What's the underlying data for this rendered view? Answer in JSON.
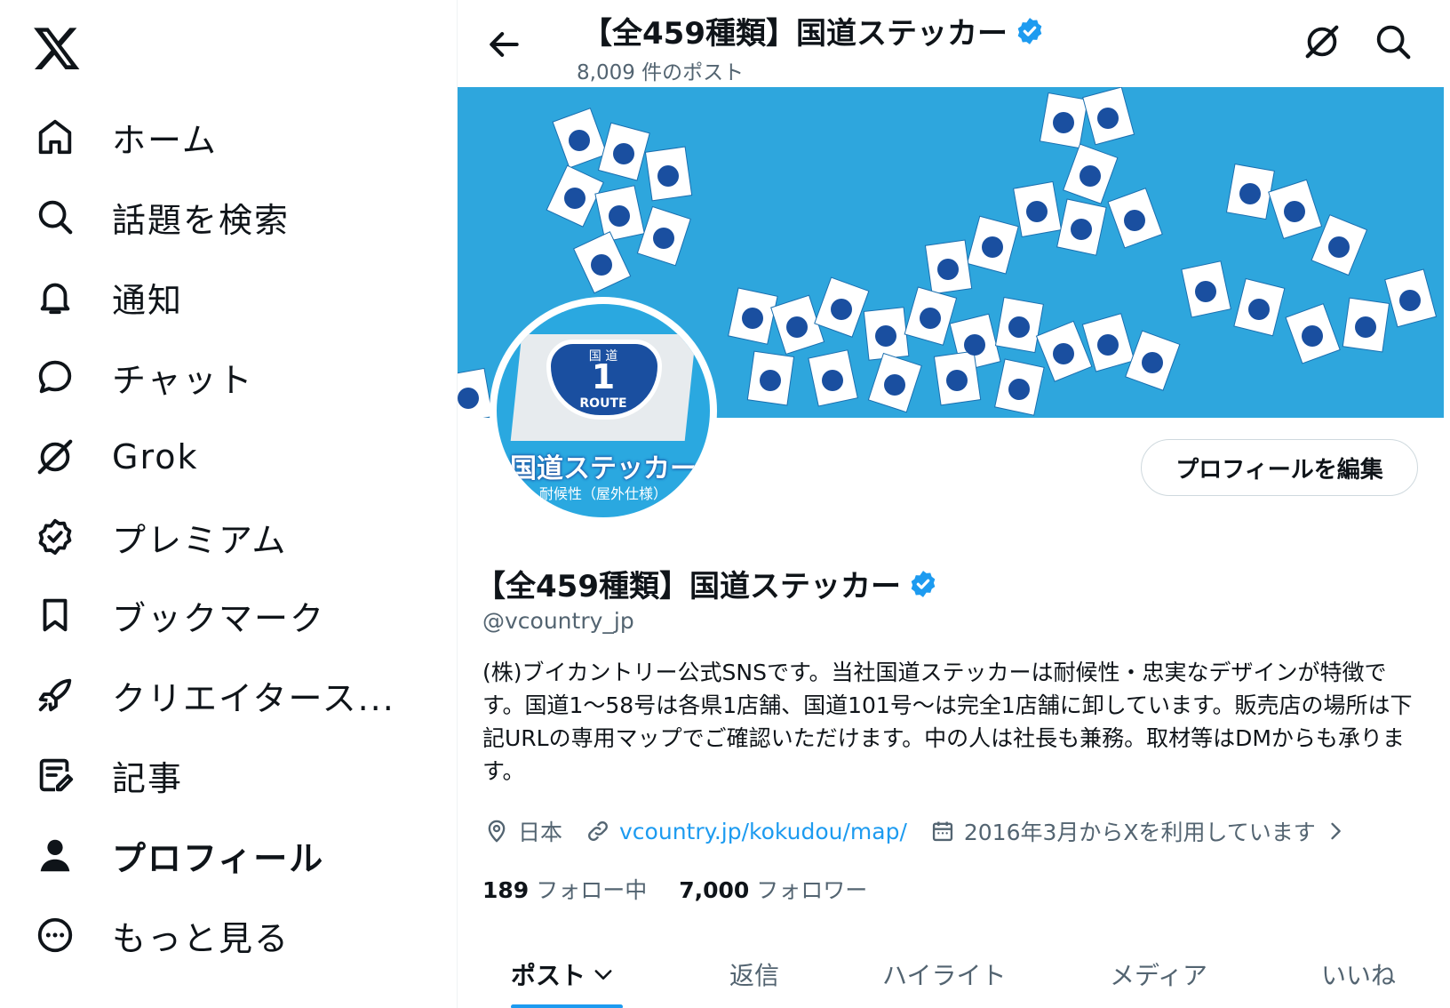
{
  "nav": {
    "items": [
      {
        "label": "ホーム",
        "icon": "home-icon"
      },
      {
        "label": "話題を検索",
        "icon": "search-icon"
      },
      {
        "label": "通知",
        "icon": "bell-icon"
      },
      {
        "label": "チャット",
        "icon": "chat-icon"
      },
      {
        "label": "Grok",
        "icon": "grok-icon"
      },
      {
        "label": "プレミアム",
        "icon": "verified-badge-icon"
      },
      {
        "label": "ブックマーク",
        "icon": "bookmark-icon"
      },
      {
        "label": "クリエイタース...",
        "icon": "rocket-icon"
      },
      {
        "label": "記事",
        "icon": "article-icon"
      },
      {
        "label": "プロフィール",
        "icon": "person-icon"
      },
      {
        "label": "もっと見る",
        "icon": "more-circle-icon"
      }
    ]
  },
  "header": {
    "title": "【全459種類】国道ステッカー",
    "post_count": "8,009 件のポスト"
  },
  "avatar": {
    "kokudo": "国 道",
    "number": "1",
    "route": "ROUTE",
    "brand": "国道ステッカー",
    "brand_sub": "耐候性（屋外仕様）"
  },
  "profile": {
    "edit_button": "プロフィールを編集",
    "name": "【全459種類】国道ステッカー",
    "handle": "@vcountry_jp",
    "bio": "(株)ブイカントリー公式SNSです。当社国道ステッカーは耐候性・忠実なデザインが特徴です。国道1～58号は各県1店舗、国道101号～は完全1店舗に卸しています。販売店の場所は下記URLの専用マップでご確認いただけます。中の人は社長も兼務。取材等はDMからも承ります。",
    "location": "日本",
    "url": "vcountry.jp/kokudou/map/",
    "joined": "2016年3月からXを利用しています",
    "following_count": "189",
    "following_label": "フォロー中",
    "followers_count": "7,000",
    "followers_label": "フォロワー"
  },
  "tabs": [
    "ポスト",
    "返信",
    "ハイライト",
    "メディア",
    "いいね"
  ],
  "colors": {
    "accent": "#1d9bf0",
    "banner": "#2ea6dd",
    "text": "#0f1419",
    "muted": "#536471"
  }
}
